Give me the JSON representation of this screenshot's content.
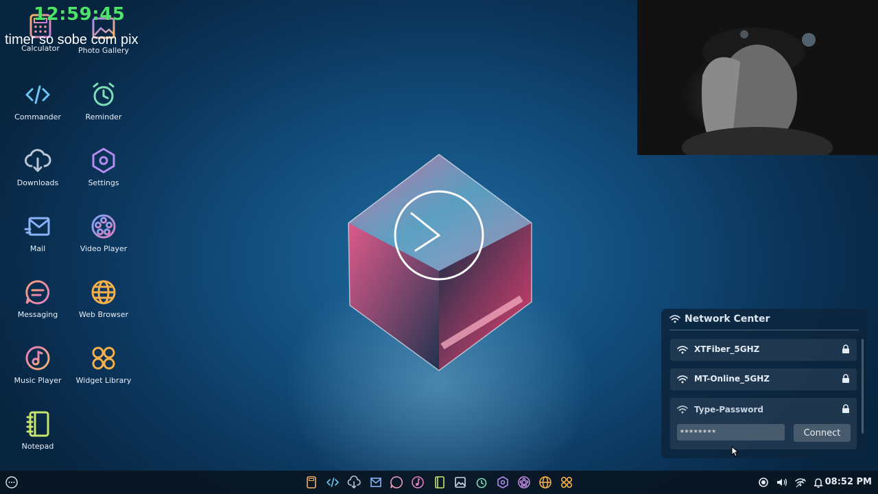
{
  "overlay": {
    "timer": "12:59:45",
    "caption": "timer so sobe com pix"
  },
  "desktop_icons": [
    {
      "label": "Calculator"
    },
    {
      "label": "Photo Gallery"
    },
    {
      "label": "Commander"
    },
    {
      "label": "Reminder"
    },
    {
      "label": "Downloads"
    },
    {
      "label": "Settings"
    },
    {
      "label": "Mail"
    },
    {
      "label": "Video Player"
    },
    {
      "label": "Messaging"
    },
    {
      "label": "Web Browser"
    },
    {
      "label": "Music Player"
    },
    {
      "label": "Widget Library"
    },
    {
      "label": "Notepad"
    }
  ],
  "network_center": {
    "title": "Network Center",
    "networks": [
      {
        "name": "XTFiber_5GHZ",
        "locked": true
      },
      {
        "name": "MT-Online_5GHZ",
        "locked": true
      },
      {
        "name": "Type-Password",
        "locked": true
      }
    ],
    "password_value": "********",
    "connect_label": "Connect"
  },
  "taskbar": {
    "apps": [
      "calculator-icon",
      "commander-icon",
      "downloads-icon",
      "mail-icon",
      "messaging-icon",
      "music-player-icon",
      "notepad-icon",
      "photo-gallery-icon",
      "reminder-icon",
      "settings-icon",
      "video-player-icon",
      "web-browser-icon",
      "widget-library-icon"
    ],
    "tray": [
      "record-icon",
      "volume-icon",
      "wifi-icon",
      "bell-icon"
    ],
    "time": "08:52 PM"
  },
  "colors": {
    "accent": "#4be36a",
    "desktop_bg": "#114a78",
    "panel": "#0c263e"
  }
}
